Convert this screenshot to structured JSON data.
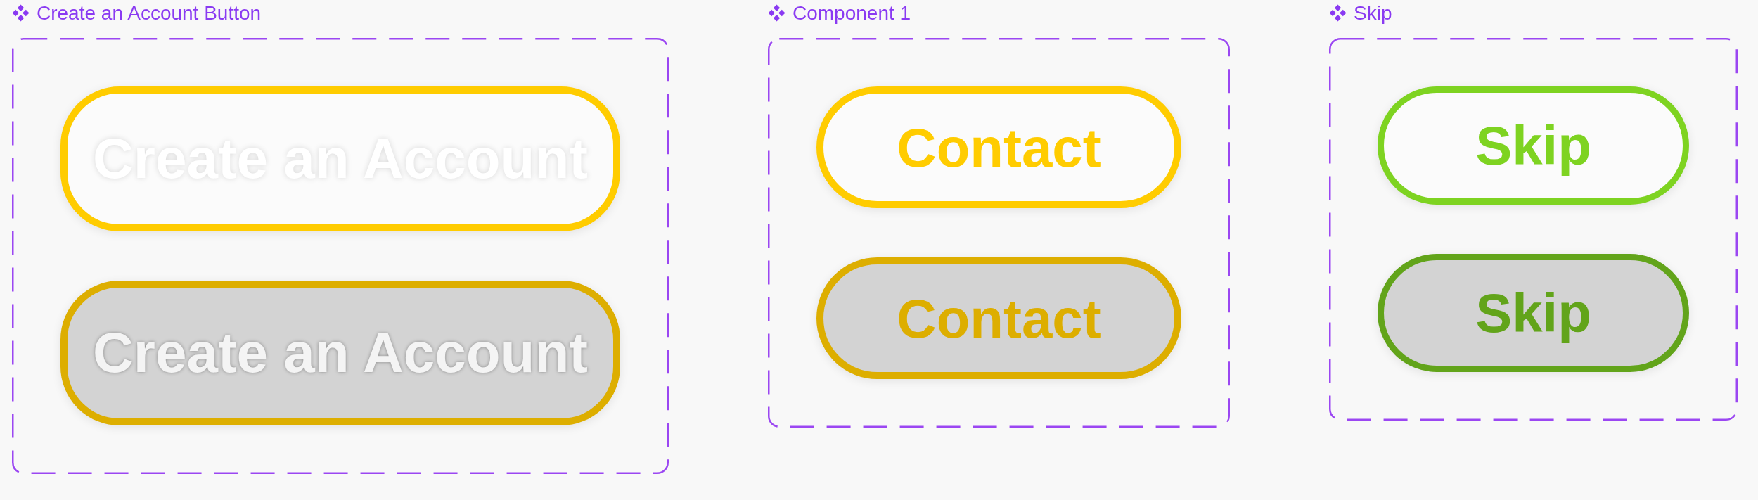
{
  "component_sets": [
    {
      "title": "Create an Account Button",
      "kind": "inverse",
      "variants": [
        {
          "label": "Create an Account",
          "pressed": false,
          "color": "#ffcc00"
        },
        {
          "label": "Create an Account",
          "pressed": true,
          "color": "#ddae00"
        }
      ]
    },
    {
      "title": "Component 1",
      "kind": "accent",
      "variants": [
        {
          "label": "Contact",
          "pressed": false,
          "color": "#ffcc00"
        },
        {
          "label": "Contact",
          "pressed": true,
          "color": "#ddae00"
        }
      ]
    },
    {
      "title": "Skip",
      "kind": "accent",
      "variants": [
        {
          "label": "Skip",
          "pressed": false,
          "color": "#7ed321"
        },
        {
          "label": "Skip",
          "pressed": true,
          "color": "#62a41a"
        }
      ]
    }
  ]
}
